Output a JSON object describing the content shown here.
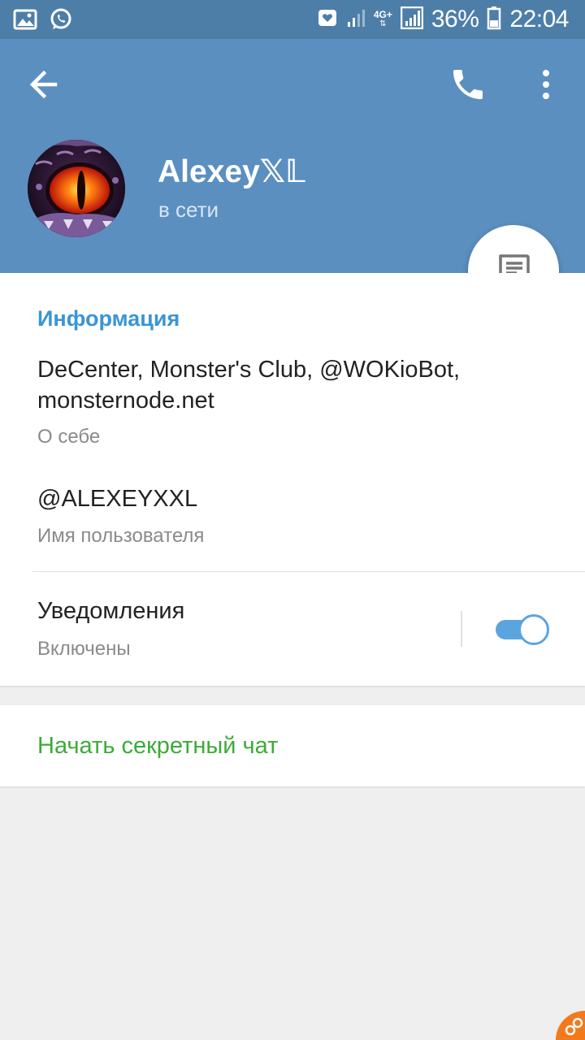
{
  "status_bar": {
    "left_icons": [
      "image-icon",
      "whatsapp-icon"
    ],
    "right_icons": [
      "notification-heart-icon",
      "signal-icon",
      "4g-icon",
      "signal-full-icon",
      "battery-icon"
    ],
    "network_label": "4G+",
    "battery": "36%",
    "time": "22:04"
  },
  "header": {
    "back_icon": "arrow-left-icon",
    "call_icon": "phone-icon",
    "menu_icon": "more-vertical-icon",
    "name": "Alexey𝕏𝕃",
    "status": "в сети",
    "background_color": "#5b8fc0"
  },
  "fab": {
    "icon": "message-icon"
  },
  "info": {
    "section_title": "Информация",
    "bio": "DeCenter, Monster's Club, @WOKioBot, monsternode.net",
    "bio_label": "О себе",
    "username": "@ALEXEYXXL",
    "username_label": "Имя пользователя",
    "notifications_title": "Уведомления",
    "notifications_status": "Включены",
    "notifications_enabled": true
  },
  "secret_chat": {
    "label": "Начать секретный чат",
    "color": "#3cab38"
  },
  "colors": {
    "accent": "#3a95d5",
    "toggle": "#5aa5e0"
  }
}
